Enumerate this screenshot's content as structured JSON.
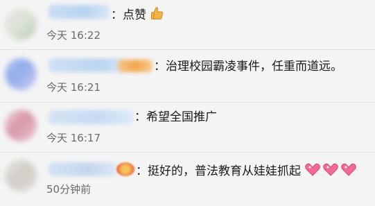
{
  "comments": [
    {
      "text": "：点赞",
      "emoji": "thumbs-up-icon",
      "time": "今天 16:22"
    },
    {
      "text": "：治理校园霸凌事件，任重而道远。",
      "time": "今天 16:21"
    },
    {
      "text": "：希望全国推广",
      "time": "今天 16:17"
    },
    {
      "text": "：挺好的，普法教育从娃娃抓起",
      "emoji": "heart-sparkle-icon",
      "time": "50分钟前"
    }
  ]
}
